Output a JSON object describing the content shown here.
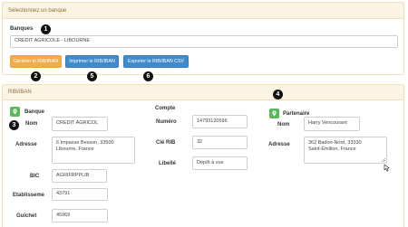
{
  "select_panel": {
    "heading": "Sélectionnez un banque",
    "banques_label": "Banques",
    "banque_select_value": "CREDIT AGRICOLE - LIBOURNE",
    "buttons": {
      "generate": "Générer le RIB/IBAN",
      "print": "Imprimer le RIB/IBAN",
      "export": "Exporter le RIB/IBAN CSV"
    },
    "accent_color": "#f0ad4e",
    "primary_color": "#428bca"
  },
  "markers": {
    "banques": "1",
    "generate": "2",
    "banque_section": "3",
    "partenaire_section": "4",
    "print": "5",
    "export": "6"
  },
  "rib_panel": {
    "heading": "RIB/IBAN",
    "banque": {
      "title": "Banque",
      "nom_label": "Nom",
      "nom_value": "CREDIT AGRICOL",
      "adresse_label": "Adresse",
      "adresse_value": "6 Impasse Besson, 33500\nLibourne, France",
      "bic_label": "BIC",
      "bic_value": "AGRIFRPPLIB",
      "etablissement_label": "Etablisseme",
      "etablissement_value": "43791",
      "guichet_label": "Guichet",
      "guichet_value": "45969"
    },
    "compte": {
      "title": "Compte",
      "numero_label": "Numéro",
      "numero_value": "14793120596",
      "cle_rib_label": "Clé RIB",
      "cle_rib_value": "32",
      "libelle_label": "Libellé",
      "libelle_value": "Dépôt à vue"
    },
    "partenaire": {
      "title": "Partenaire",
      "nom_label": "Nom",
      "nom_value": "Harry Vencourant",
      "adresse_label": "Adresse",
      "adresse_value": "362 Badon-Nord, 33330\nSaint-Émilion, France"
    },
    "icon_color": "#5cb85c"
  }
}
